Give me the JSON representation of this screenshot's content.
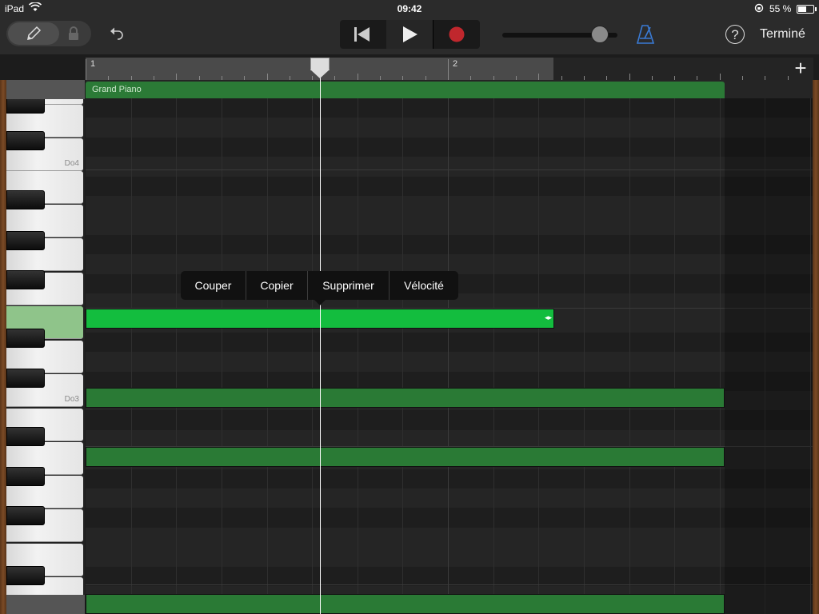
{
  "status_bar": {
    "device": "iPad",
    "time": "09:42",
    "battery": "55 %",
    "battery_level": 0.55
  },
  "toolbar": {
    "tools": [
      "pencil-icon",
      "lock-icon"
    ],
    "undo_icon": "undo-icon",
    "transport": [
      "rewind-icon",
      "play-icon",
      "record-icon"
    ],
    "record_color": "#c0272d",
    "volume_level": 0.88,
    "metronome_color": "#3a7bd5",
    "help_label": "?",
    "done_label": "Terminé"
  },
  "ruler": {
    "bar_labels": [
      "1",
      "2"
    ],
    "add_label": "+"
  },
  "track": {
    "region_name": "Grand Piano",
    "accent": "#2b7a36",
    "selected_note_color": "#13bd3e"
  },
  "keyboard": {
    "labels": [
      "Do4",
      "Do3"
    ]
  },
  "context_menu": {
    "items": [
      "Couper",
      "Copier",
      "Supprimer",
      "Vélocité"
    ]
  }
}
